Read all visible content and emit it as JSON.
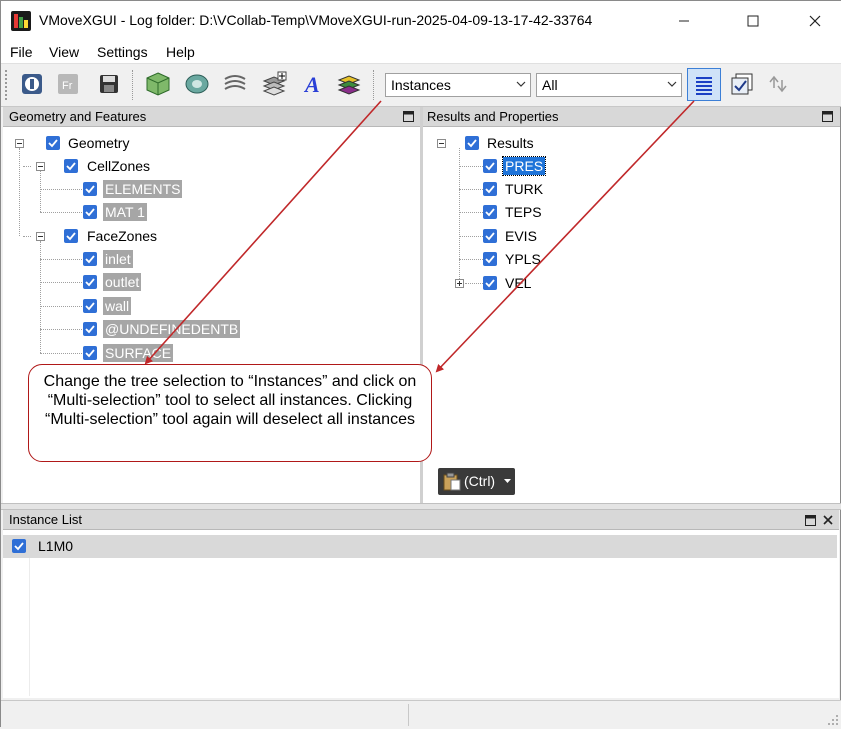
{
  "window": {
    "title": "VMoveXGUI - Log folder: D:\\VCollab-Temp\\VMoveXGUI-run-2025-04-09-13-17-42-33764",
    "minimize": "—",
    "maximize": "☐",
    "close": "✕"
  },
  "menu": [
    "File",
    "View",
    "Settings",
    "Help"
  ],
  "toolbar": {
    "tree_selection": "Instances",
    "filter": "All"
  },
  "geometry_panel": {
    "title": "Geometry and Features",
    "root": "Geometry",
    "cell_zones": {
      "label": "CellZones",
      "items": [
        "ELEMENTS",
        "MAT 1"
      ]
    },
    "face_zones": {
      "label": "FaceZones",
      "items": [
        "inlet",
        "outlet",
        "wall",
        "@UNDEFINEDENTB",
        "SURFACE"
      ]
    }
  },
  "results_panel": {
    "title": "Results and Properties",
    "root": "Results",
    "items": [
      "PRES",
      "TURK",
      "TEPS",
      "EVIS",
      "YPLS",
      "VEL"
    ],
    "paste_label": "(Ctrl)"
  },
  "instance_panel": {
    "title": "Instance List",
    "items": [
      "L1M0"
    ]
  },
  "callout": {
    "text": "Change the tree selection to “Instances” and click on “Multi-selection” tool to select all instances. Clicking “Multi-selection” tool again will deselect all instances"
  },
  "colors": {
    "accent": "#1f74d9",
    "callout_border": "#b01818",
    "arrow": "#c0282a",
    "highlight": "#a6a6a6"
  }
}
